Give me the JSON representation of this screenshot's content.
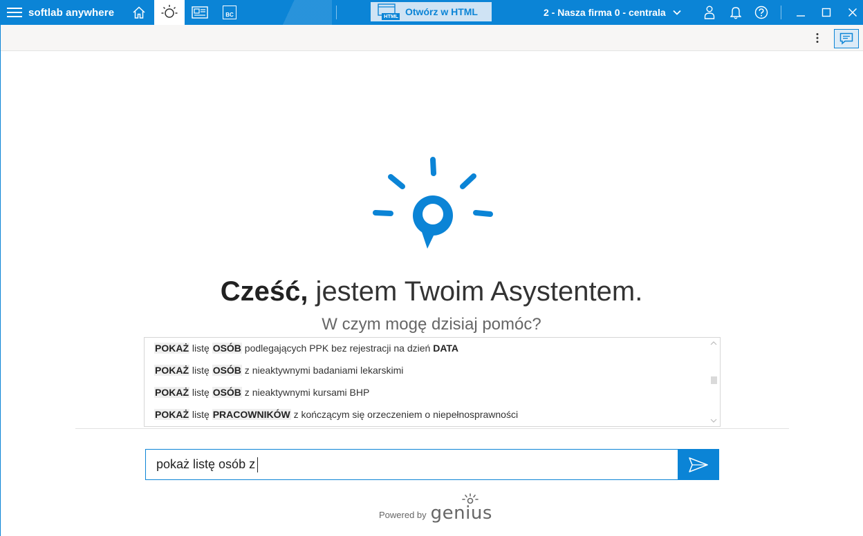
{
  "titlebar": {
    "app_name": "softlab anywhere",
    "open_html_label": "Otwórz w HTML",
    "open_html_icon_text": "HTML",
    "bc_icon_text": "BC",
    "company": "2 - Nasza firma 0 - centrala"
  },
  "main": {
    "greeting_bold": "Cześć,",
    "greeting_rest": " jestem Twoim Asystentem.",
    "subtitle": "W czym mogę dzisiaj pomóc?"
  },
  "suggestions": [
    {
      "verb": "POKAŻ",
      "w1": " listę ",
      "obj": "OSÓB",
      "rest": " podlegających PPK bez rejestracji na dzień ",
      "tail": "DATA"
    },
    {
      "verb": "POKAŻ",
      "w1": " listę ",
      "obj": "OSÓB",
      "rest": " z nieaktywnymi badaniami lekarskimi",
      "tail": ""
    },
    {
      "verb": "POKAŻ",
      "w1": " listę ",
      "obj": "OSÓB",
      "rest": " z nieaktywnymi kursami BHP",
      "tail": ""
    },
    {
      "verb": "POKAŻ",
      "w1": " listę ",
      "obj": "PRACOWNIKÓW",
      "rest": " z kończącym się orzeczeniem o niepełnosprawności",
      "tail": ""
    }
  ],
  "input": {
    "value": "pokaż listę osób z"
  },
  "footer": {
    "powered_by": "Powered by",
    "brand": "genius"
  },
  "colors": {
    "accent": "#0b84d6",
    "accent_light": "#cfe3f4"
  }
}
